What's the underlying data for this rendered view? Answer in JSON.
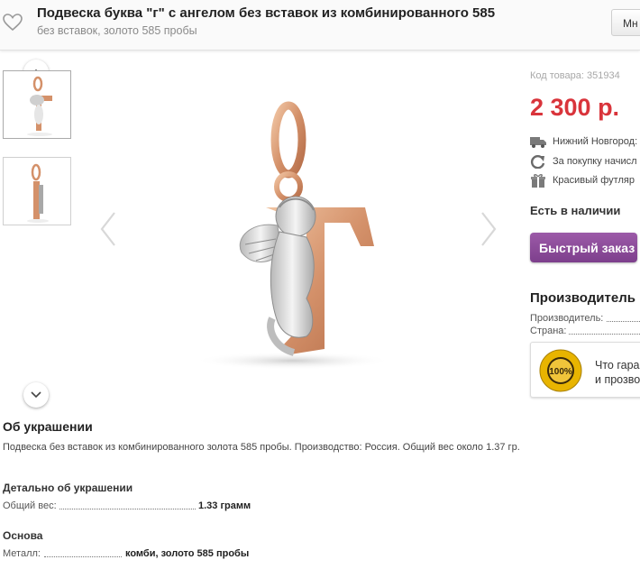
{
  "header": {
    "title": "Подвеска буква \"г\" с ангелом без вставок из комбинированного 585",
    "subtitle": "без вставок, золото 585 пробы",
    "more_button": "Мн"
  },
  "product": {
    "sku": "Код товара: 351934",
    "price": "2 300 р.",
    "features": [
      {
        "icon": "delivery-truck-icon",
        "text": "Нижний Новгород:"
      },
      {
        "icon": "bonus-refresh-icon",
        "text": "За покупку начисл"
      },
      {
        "icon": "gift-box-icon",
        "text": "Красивый футляр"
      }
    ],
    "stock": "Есть в наличии",
    "quick_order": "Быстрый заказ"
  },
  "manufacturer": {
    "heading": "Производитель и",
    "rows": [
      {
        "label": "Производитель:"
      },
      {
        "label": "Страна:"
      }
    ]
  },
  "guarantee": {
    "line1": "Что гара",
    "line2": "и прозво",
    "seal_text": "100%"
  },
  "about": {
    "heading": "Об украшении",
    "text": "Подвеска без вставок из комбинированного золота 585 пробы. Производство: Россия. Общий вес около 1.37 гр."
  },
  "details": {
    "heading": "Детально об украшении",
    "weight_label": "Общий вес:",
    "weight_value": "1.33 грамм"
  },
  "basis": {
    "heading": "Основа",
    "metal_label": "Металл:",
    "metal_value": "комби, золото 585 пробы"
  },
  "colors": {
    "price": "#d9343b",
    "button": "#8a4a99",
    "rose_gold": "#d4916a",
    "white_gold": "#e2e2e2"
  }
}
